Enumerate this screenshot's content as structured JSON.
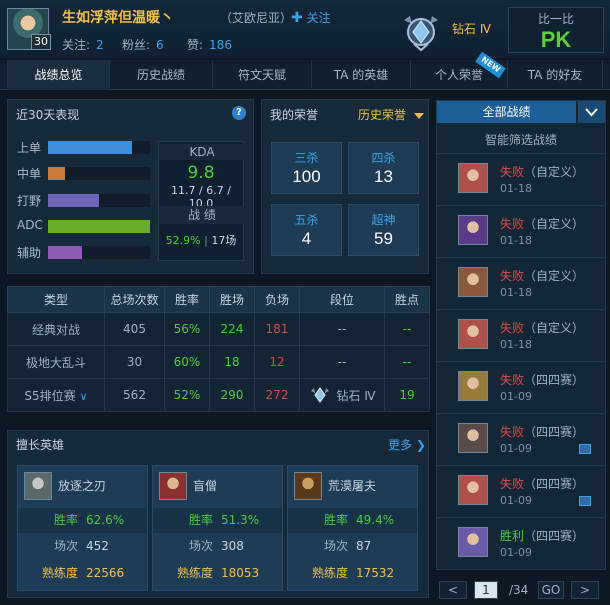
{
  "header": {
    "player_name": "生如浮萍但温暖丶",
    "level": "30",
    "server": "（艾欧尼亚）",
    "follow_label": "关注",
    "follow_icon": "plus-icon",
    "following_label": "关注:",
    "following_count": "2",
    "fans_label": "粉丝:",
    "fans_count": "6",
    "likes_label": "赞:",
    "likes_count": "186",
    "rank_text": "钻石 Ⅳ",
    "pk_top": "比一比",
    "pk_main": "PK"
  },
  "tabs": [
    "战绩总览",
    "历史战绩",
    "符文天赋",
    "TA 的英雄",
    "个人荣誉",
    "TA 的好友"
  ],
  "active_tab": 0,
  "new_badge": "NEW",
  "recent": {
    "title": "近30天表现",
    "help": "?",
    "positions": [
      {
        "label": "上单",
        "fraction": 0.82,
        "color": "#3f8fd6"
      },
      {
        "label": "中单",
        "fraction": 0.17,
        "color": "#c97b3e"
      },
      {
        "label": "打野",
        "fraction": 0.5,
        "color": "#6e64b8"
      },
      {
        "label": "ADC",
        "fraction": 1.0,
        "color": "#6aad2c"
      },
      {
        "label": "辅助",
        "fraction": 0.33,
        "color": "#8c5bb3"
      }
    ],
    "kda_label": "KDA",
    "kda_value": "9.8",
    "kda_detail": "11.7 / 6.7 / 10.0",
    "record_label": "战 绩",
    "winrate": "52.9%",
    "games": "17场"
  },
  "honors": {
    "title": "我的荣誉",
    "dropdown": "历史荣誉",
    "items": [
      {
        "label": "三杀",
        "value": "100"
      },
      {
        "label": "四杀",
        "value": "13"
      },
      {
        "label": "五杀",
        "value": "4"
      },
      {
        "label": "超神",
        "value": "59"
      }
    ]
  },
  "stats_table": {
    "headers": [
      "类型",
      "总场次数",
      "胜率",
      "胜场",
      "负场",
      "段位",
      "胜点"
    ],
    "rows": [
      {
        "type": "经典对战",
        "total": "405",
        "winrate": "56%",
        "wins": "224",
        "losses": "181",
        "rank": "--",
        "points": "--"
      },
      {
        "type": "极地大乱斗",
        "total": "30",
        "winrate": "60%",
        "wins": "18",
        "losses": "12",
        "rank": "--",
        "points": "--"
      },
      {
        "type": "S5排位赛",
        "total": "562",
        "winrate": "52%",
        "wins": "290",
        "losses": "272",
        "rank": "钻石 Ⅳ",
        "points": "19"
      }
    ]
  },
  "heroes": {
    "title": "擅长英雄",
    "more": "更多",
    "win_label": "胜率",
    "games_label": "场次",
    "prof_label": "熟练度",
    "items": [
      {
        "name": "放逐之刃",
        "winrate": "62.6%",
        "games": "452",
        "proficiency": "22566",
        "color": "#9aa8a8"
      },
      {
        "name": "盲僧",
        "winrate": "51.3%",
        "games": "308",
        "proficiency": "18053",
        "color": "#b0504a"
      },
      {
        "name": "荒漠屠夫",
        "winrate": "49.4%",
        "games": "87",
        "proficiency": "17532",
        "color": "#8a6a3a"
      }
    ]
  },
  "matches": {
    "all_label": "全部战绩",
    "smart_label": "智能筛选战绩",
    "items": [
      {
        "result": "失败",
        "mode": "（自定义）",
        "date": "01-18",
        "color": "#b0504a",
        "has_image": false
      },
      {
        "result": "失败",
        "mode": "（自定义）",
        "date": "01-18",
        "color": "#5a3a8a",
        "has_image": false
      },
      {
        "result": "失败",
        "mode": "（自定义）",
        "date": "01-18",
        "color": "#8a5a3a",
        "has_image": false
      },
      {
        "result": "失败",
        "mode": "（自定义）",
        "date": "01-18",
        "color": "#b0504a",
        "has_image": false
      },
      {
        "result": "失败",
        "mode": "（四四赛）",
        "date": "01-09",
        "color": "#9a7a3a",
        "has_image": false
      },
      {
        "result": "失败",
        "mode": "（四四赛）",
        "date": "01-09",
        "color": "#5a4a4a",
        "has_image": true
      },
      {
        "result": "失败",
        "mode": "（四四赛）",
        "date": "01-09",
        "color": "#b0504a",
        "has_image": true
      },
      {
        "result": "胜利",
        "mode": "（四四赛）",
        "date": "01-09",
        "color": "#6a5aa8",
        "has_image": false
      }
    ]
  },
  "pager": {
    "prev": "<",
    "current": "1",
    "total": "/34",
    "go": "GO",
    "next": ">"
  }
}
